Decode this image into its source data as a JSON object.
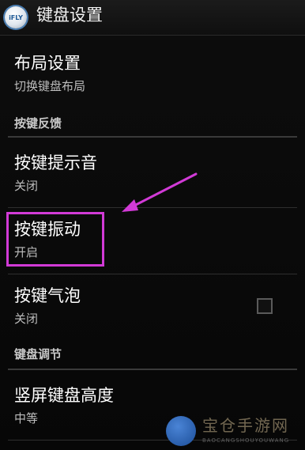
{
  "actionbar": {
    "logo_text": "iFLY",
    "title": "键盘设置"
  },
  "items": [
    {
      "title": "布局设置",
      "summary": "切换键盘布局"
    },
    {
      "title": "按键提示音",
      "summary": "关闭"
    },
    {
      "title": "按键振动",
      "summary": "开启"
    },
    {
      "title": "按键气泡",
      "summary": "关闭",
      "checked": false
    },
    {
      "title": "竖屏键盘高度",
      "summary": "中等"
    }
  ],
  "headers": {
    "key_feedback": "按键反馈",
    "keyboard_adjust": "键盘调节"
  },
  "annotation": {
    "arrow_color": "#d13ad6",
    "box_color": "#d13ad6"
  },
  "watermark": {
    "text": "宝仓手游网",
    "subtext": "BAOCANGSHOUYOUWANG"
  },
  "colors": {
    "background": "#0a0a0a",
    "title_text": "#ffffff",
    "summary_text": "#bdbdbd",
    "accent": "#d13ad6"
  }
}
